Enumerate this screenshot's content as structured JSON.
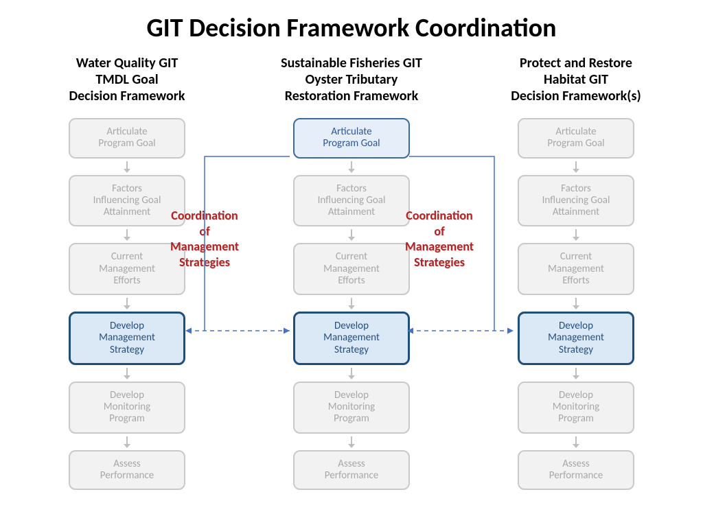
{
  "title": "GIT Decision Framework Coordination",
  "columns": [
    {
      "header": "Water Quality GIT\nTMDL Goal\nDecision Framework",
      "highlight_index": 3,
      "highlight_first": false
    },
    {
      "header": "Sustainable Fisheries GIT\nOyster Tributary\nRestoration Framework",
      "highlight_index": 3,
      "highlight_first": true
    },
    {
      "header": "Protect and Restore\nHabitat GIT\nDecision Framework(s)",
      "highlight_index": 3,
      "highlight_first": false
    }
  ],
  "steps": [
    "Articulate\nProgram Goal",
    "Factors\nInfluencing Goal\nAttainment",
    "Current\nManagement\nEfforts",
    "Develop\nManagement\nStrategy",
    "Develop\nMonitoring\nProgram",
    "Assess\nPerformance"
  ],
  "coord_label": "Coordination\nof\nManagement\nStrategies"
}
